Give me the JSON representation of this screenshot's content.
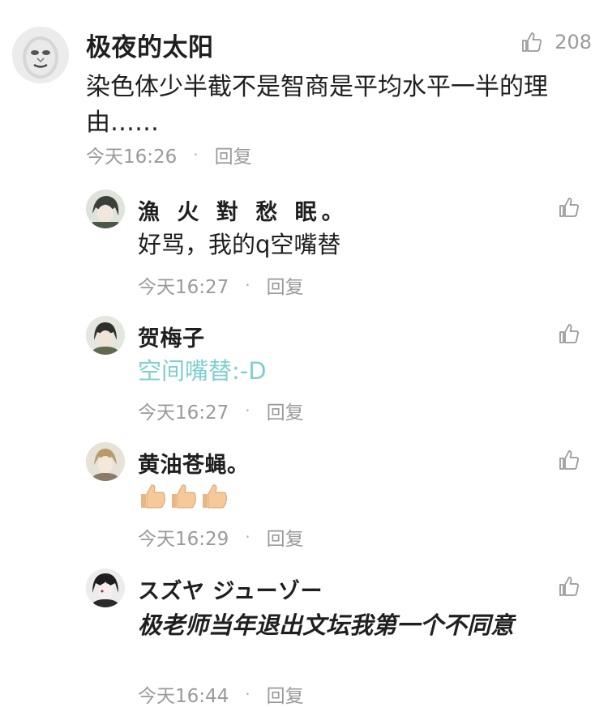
{
  "main_comment": {
    "username": "极夜的太阳",
    "text": "染色体少半截不是智商是平均水平一半的理由……",
    "time": "今天16:26",
    "reply_label": "回复",
    "like_count": "208"
  },
  "replies": [
    {
      "username": "漁 火 對 愁 眠。",
      "text": "好骂，我的q空嘴替",
      "time": "今天16:27",
      "reply_label": "回复"
    },
    {
      "username": "贺梅子",
      "text": "空间嘴替:-D",
      "time": "今天16:27",
      "reply_label": "回复"
    },
    {
      "username": "黄油苍蝇。",
      "emoji": "thumbs-up-icon ×3",
      "time": "今天16:29",
      "reply_label": "回复"
    },
    {
      "username": "スズヤ ジューゾー",
      "text": "极老师当年退出文坛我第一个不同意",
      "time": "今天16:44",
      "reply_label": "回复"
    }
  ],
  "colors": {
    "meta_gray": "#9a9a9a",
    "cyan_text": "#7fcfd0",
    "thumb_skin": "#f6c89a"
  }
}
